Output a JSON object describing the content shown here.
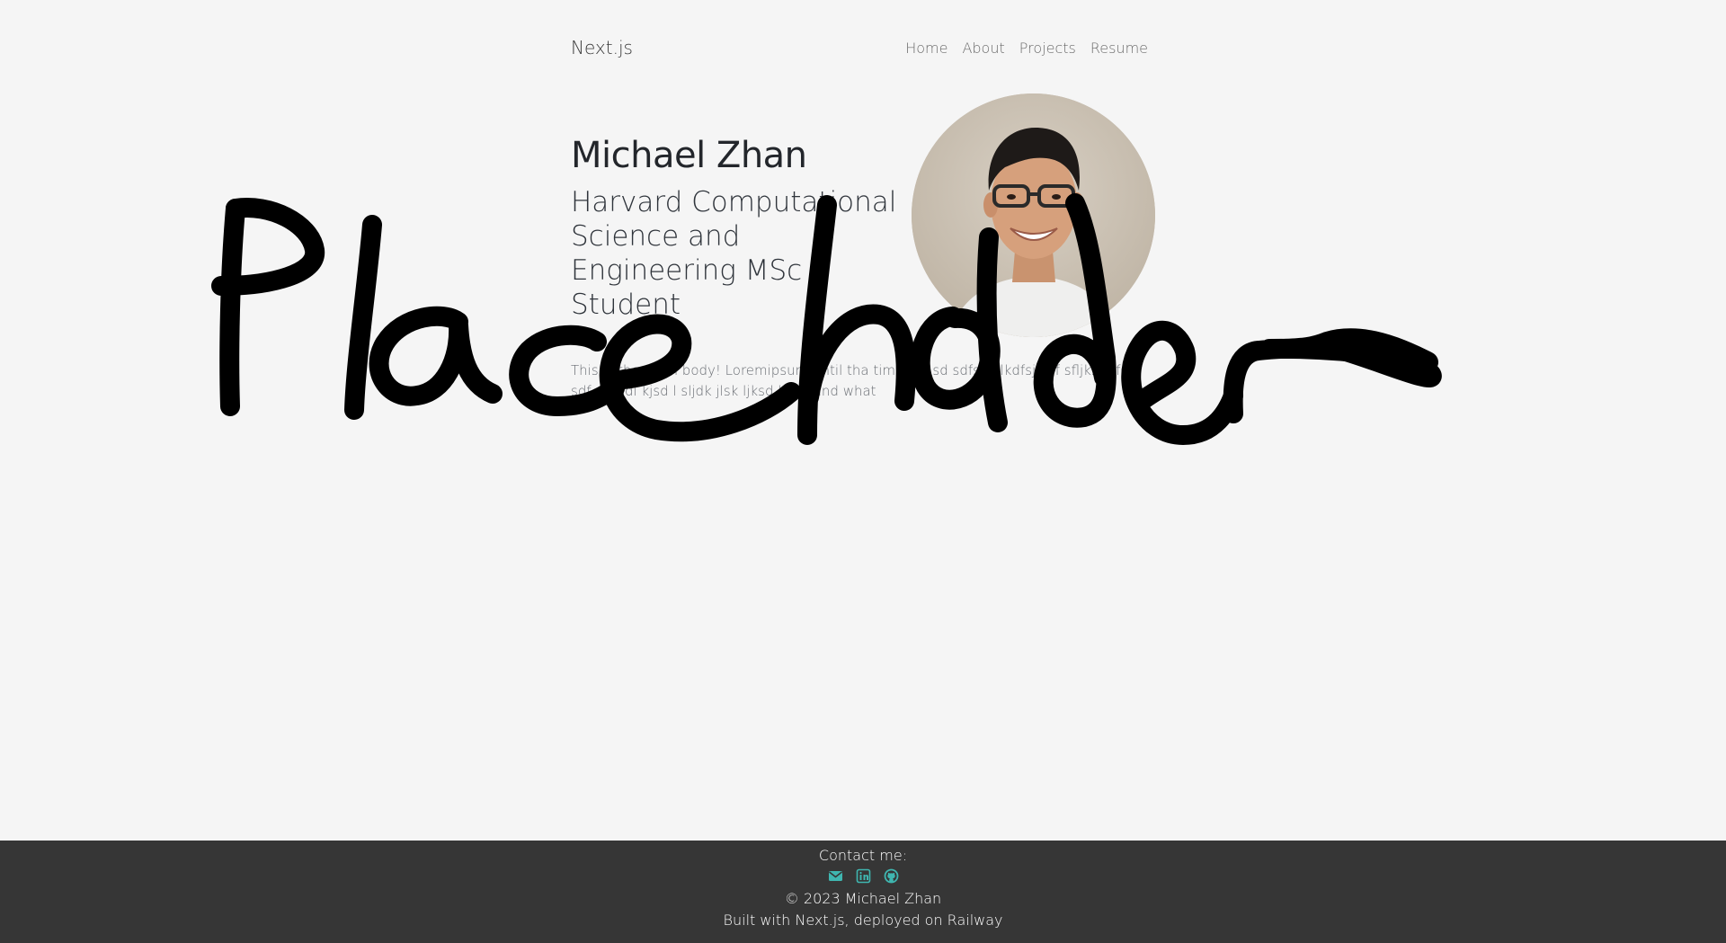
{
  "nav": {
    "brand": "Next.js",
    "links": [
      {
        "label": "Home"
      },
      {
        "label": "About"
      },
      {
        "label": "Projects"
      },
      {
        "label": "Resume"
      }
    ]
  },
  "hero": {
    "name": "Michael Zhan",
    "subtitle": "Harvard Computational Science and Engineering MSc Student",
    "body": "This is the main body! Loremipsum until tha time sdf sd sdfsdfslkdfsjlsdf sfljksdf fsdf sdf sljksdl kjsd l sljdk jlsk ljksd burb and what"
  },
  "overlay": {
    "scribble_text": "Placeholder"
  },
  "footer": {
    "contact_label": "Contact me:",
    "icons": [
      "envelope-icon",
      "linkedin-icon",
      "github-icon"
    ],
    "icon_color": "#3fb6b0",
    "copyright": "© 2023 Michael Zhan",
    "built_with": "Built with Next.js, deployed on Railway"
  },
  "colors": {
    "background": "#f5f5f5",
    "footer_background": "#363636",
    "accent": "#3fb6b0"
  }
}
